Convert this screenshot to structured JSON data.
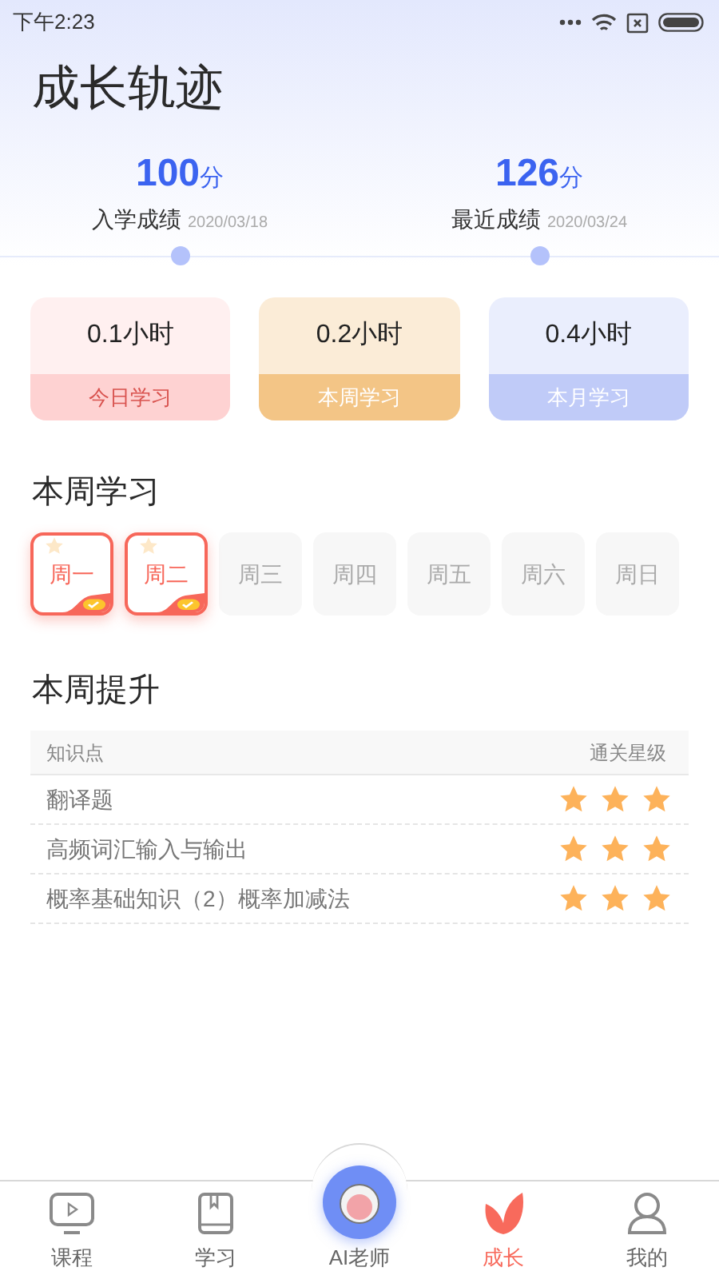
{
  "status_bar": {
    "time": "下午2:23"
  },
  "title": "成长轨迹",
  "scores": [
    {
      "value": "100",
      "unit": "分",
      "label": "入学成绩",
      "date": "2020/03/18"
    },
    {
      "value": "126",
      "unit": "分",
      "label": "最近成绩",
      "date": "2020/03/24"
    }
  ],
  "stats": [
    {
      "value": "0.1小时",
      "label": "今日学习",
      "color": "#fed2d2"
    },
    {
      "value": "0.2小时",
      "label": "本周学习",
      "color": "#f3c586"
    },
    {
      "value": "0.4小时",
      "label": "本月学习",
      "color": "#c0cbf8"
    }
  ],
  "week_section": {
    "title": "本周学习",
    "days": [
      {
        "label": "周一",
        "checked": true
      },
      {
        "label": "周二",
        "checked": true
      },
      {
        "label": "周三",
        "checked": false
      },
      {
        "label": "周四",
        "checked": false
      },
      {
        "label": "周五",
        "checked": false
      },
      {
        "label": "周六",
        "checked": false
      },
      {
        "label": "周日",
        "checked": false
      }
    ]
  },
  "improve_section": {
    "title": "本周提升",
    "columns": [
      "知识点",
      "通关星级"
    ],
    "rows": [
      {
        "name": "翻译题",
        "stars": 3
      },
      {
        "name": "高频词汇输入与输出",
        "stars": 3
      },
      {
        "name": "概率基础知识（2）概率加减法",
        "stars": 3
      }
    ]
  },
  "tab_bar": [
    {
      "label": "课程",
      "kind": "tv",
      "selected": false
    },
    {
      "label": "学习",
      "kind": "book",
      "selected": false
    },
    {
      "label": "AI老师",
      "kind": "mascot",
      "selected": false
    },
    {
      "label": "成长",
      "kind": "leaf",
      "selected": true
    },
    {
      "label": "我的",
      "kind": "user",
      "selected": false
    }
  ]
}
